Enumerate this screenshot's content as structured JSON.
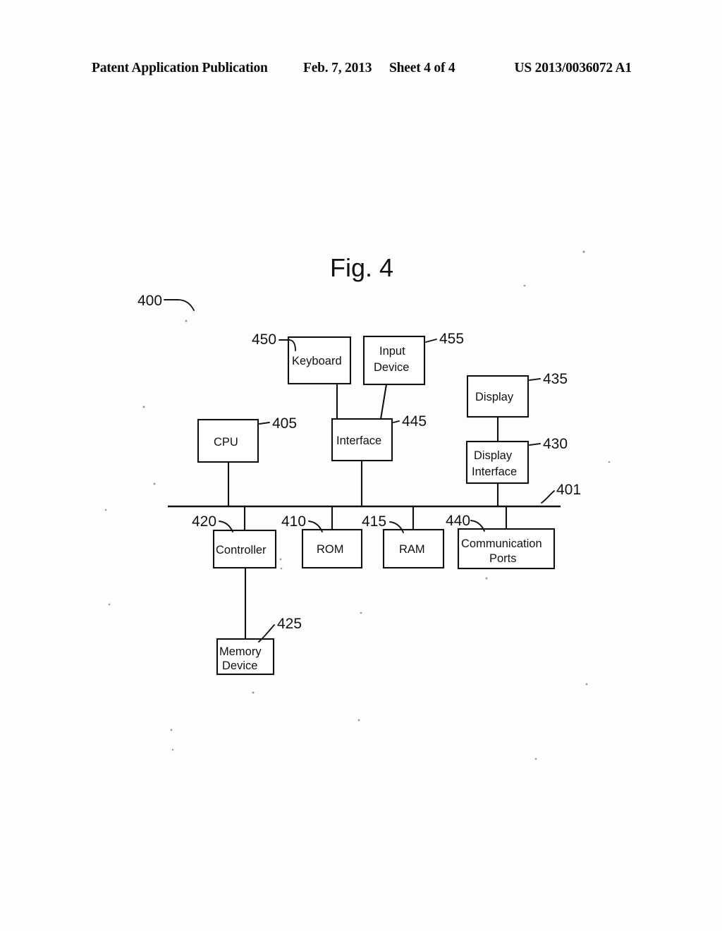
{
  "header": {
    "title": "Patent Application Publication",
    "date": "Feb. 7, 2013",
    "sheet": "Sheet 4 of 4",
    "publication_number": "US 2013/0036072 A1"
  },
  "figure": {
    "title": "Fig. 4",
    "system_ref": "400",
    "bus_ref": "401",
    "type": "block-diagram",
    "blocks": [
      {
        "id": "keyboard",
        "label": "Keyboard",
        "ref": "450",
        "ref_side": "left"
      },
      {
        "id": "input-device",
        "label": "Input\nDevice",
        "ref": "455",
        "ref_side": "right"
      },
      {
        "id": "display",
        "label": "Display",
        "ref": "435",
        "ref_side": "right"
      },
      {
        "id": "cpu",
        "label": "CPU",
        "ref": "405",
        "ref_side": "right"
      },
      {
        "id": "interface",
        "label": "Interface",
        "ref": "445",
        "ref_side": "right"
      },
      {
        "id": "display-iface",
        "label": "Display\nInterface",
        "ref": "430",
        "ref_side": "right"
      },
      {
        "id": "controller",
        "label": "Controller",
        "ref": "420",
        "ref_side": "left"
      },
      {
        "id": "rom",
        "label": "ROM",
        "ref": "410",
        "ref_side": "left"
      },
      {
        "id": "ram",
        "label": "RAM",
        "ref": "415",
        "ref_side": "left"
      },
      {
        "id": "comm-ports",
        "label": "Communication\nPorts",
        "ref": "440",
        "ref_side": "left"
      },
      {
        "id": "memory-device",
        "label": "Memory\nDevice",
        "ref": "425",
        "ref_side": "right"
      }
    ],
    "block_text": {
      "keyboard": "Keyboard",
      "input_device_line1": "Input",
      "input_device_line2": "Device",
      "display": "Display",
      "cpu": "CPU",
      "interface": "Interface",
      "display_interface_line1": "Display",
      "display_interface_line2": "Interface",
      "controller": "Controller",
      "rom": "ROM",
      "ram": "RAM",
      "comm_ports_line1": "Communication",
      "comm_ports_line2": "Ports",
      "memory_device_line1": "Memory",
      "memory_device_line2": "Device"
    },
    "refs": {
      "system": "400",
      "cpu": "405",
      "rom": "410",
      "ram": "415",
      "controller": "420",
      "memory_device": "425",
      "display_interface": "430",
      "display": "435",
      "comm_ports": "440",
      "interface": "445",
      "keyboard": "450",
      "input_device": "455",
      "bus": "401"
    },
    "connections": [
      {
        "from": "keyboard",
        "to": "interface"
      },
      {
        "from": "input-device",
        "to": "interface"
      },
      {
        "from": "display",
        "to": "display-iface"
      },
      {
        "from": "cpu",
        "to": "bus"
      },
      {
        "from": "interface",
        "to": "bus"
      },
      {
        "from": "display-iface",
        "to": "bus"
      },
      {
        "from": "controller",
        "to": "bus"
      },
      {
        "from": "rom",
        "to": "bus"
      },
      {
        "from": "ram",
        "to": "bus"
      },
      {
        "from": "comm-ports",
        "to": "bus"
      },
      {
        "from": "controller",
        "to": "memory-device"
      }
    ]
  },
  "colors": {
    "ink": "#101010",
    "paper": "#fdfdfd"
  }
}
